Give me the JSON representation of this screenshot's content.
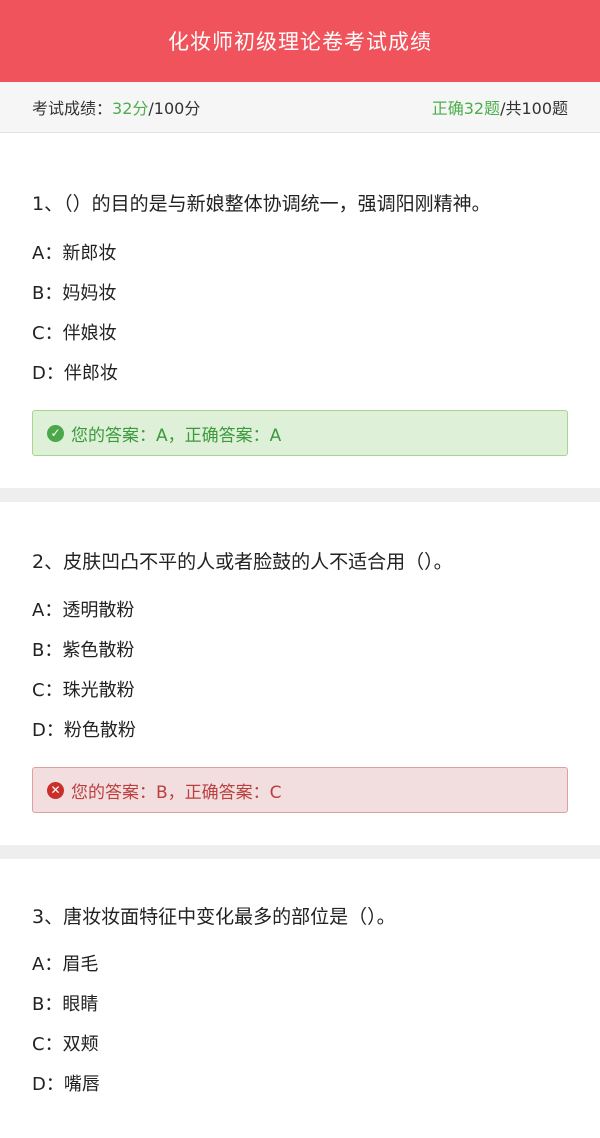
{
  "header": {
    "title": "化妆师初级理论卷考试成绩"
  },
  "summary": {
    "score_label": "考试成绩：",
    "score_value": "32分",
    "score_total": "/100分",
    "correct_label": "正确32题",
    "total_label": "/共100题"
  },
  "questions": [
    {
      "text": "1、（）的目的是与新娘整体协调统一，强调阳刚精神。",
      "options": [
        "A：新郎妆",
        "B：妈妈妆",
        "C：伴娘妆",
        "D：伴郎妆"
      ],
      "answer": "您的答案：A，正确答案：A",
      "result": "correct"
    },
    {
      "text": "2、皮肤凹凸不平的人或者脸鼓的人不适合用（）。",
      "options": [
        "A：透明散粉",
        "B：紫色散粉",
        "C：珠光散粉",
        "D：粉色散粉"
      ],
      "answer": "您的答案：B，正确答案：C",
      "result": "wrong"
    },
    {
      "text": "3、唐妆妆面特征中变化最多的部位是（）。",
      "options": [
        "A：眉毛",
        "B：眼睛",
        "C：双颊",
        "D：嘴唇"
      ]
    }
  ],
  "colors": {
    "header": "#f0535b",
    "correct": "#4cae4c",
    "wrong": "#c9302c"
  },
  "icons": {
    "correct": "check-circle-icon",
    "wrong": "x-circle-icon"
  }
}
